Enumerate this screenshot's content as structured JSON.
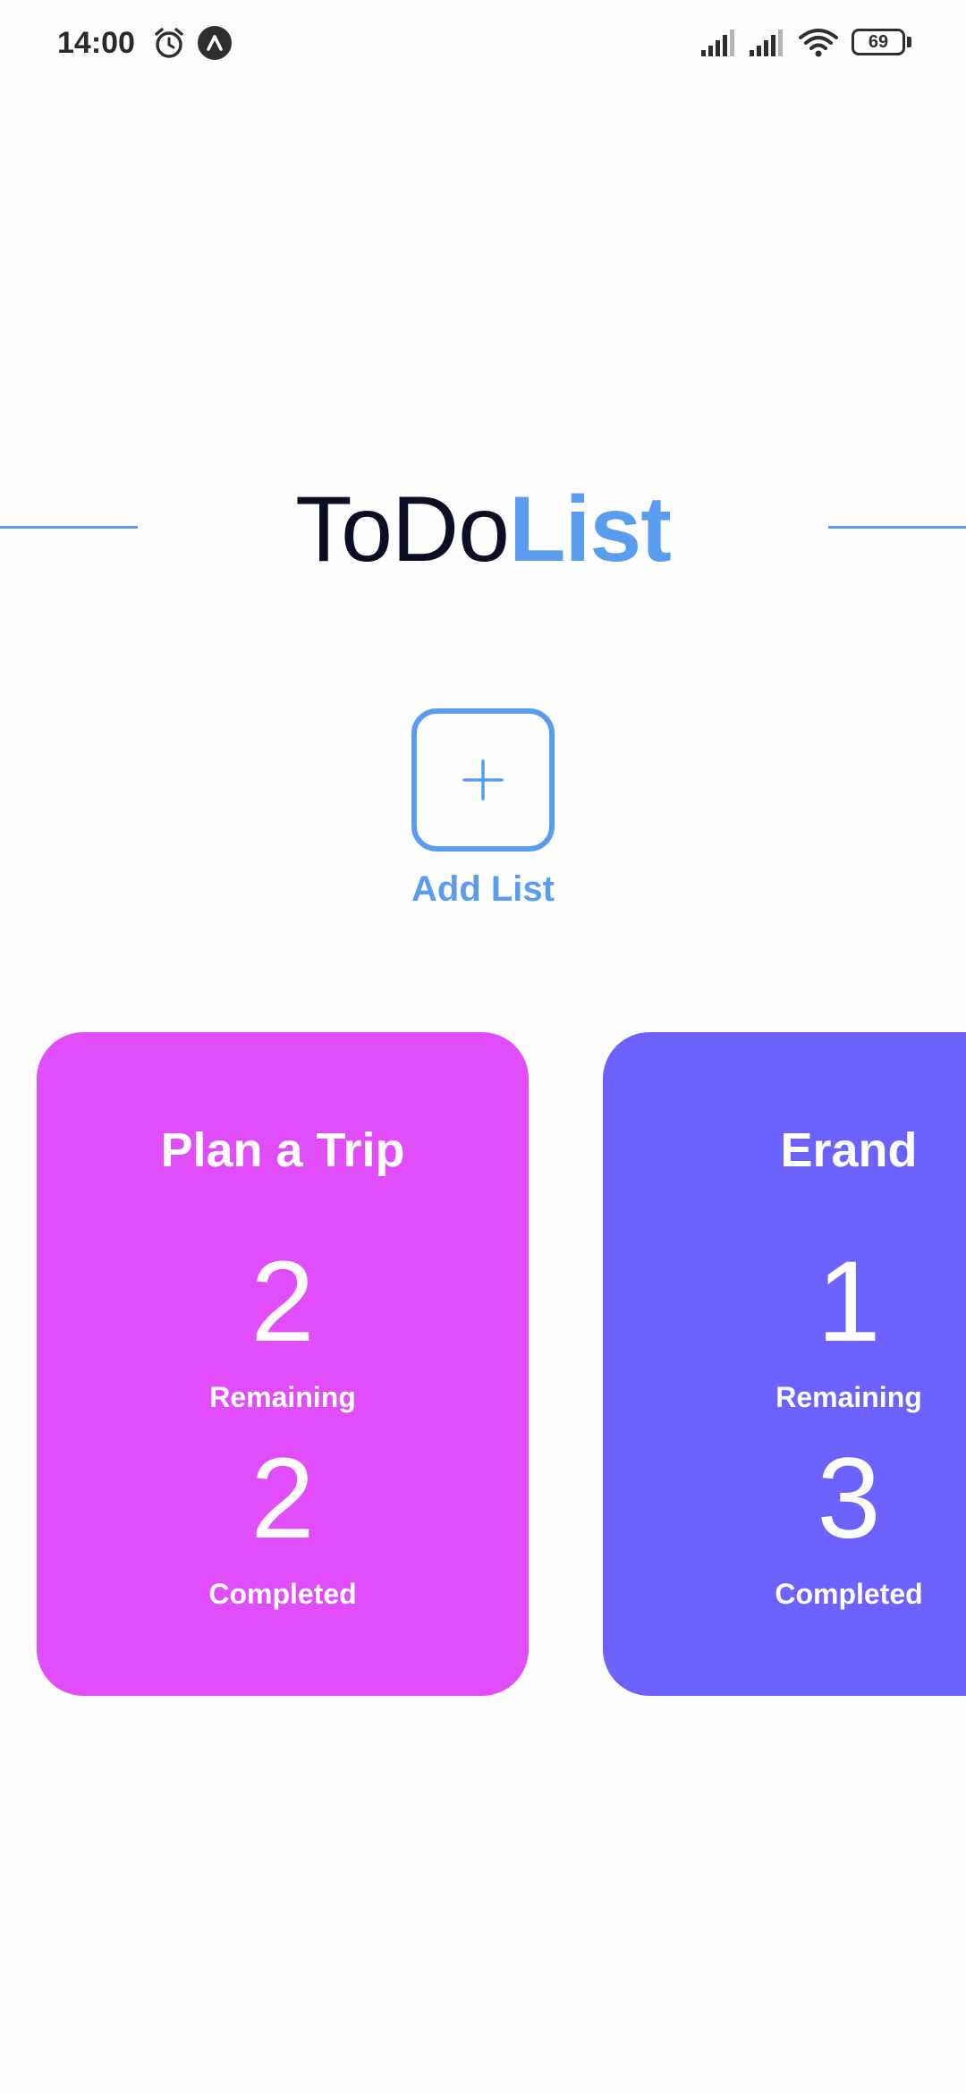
{
  "status_bar": {
    "time": "14:00",
    "battery": "69",
    "icons": [
      "alarm-icon",
      "app-notification-icon",
      "cell-signal-icon",
      "cell-signal-icon",
      "wifi-icon",
      "battery-icon"
    ]
  },
  "header": {
    "title_part1": "ToDo",
    "title_part2": "List",
    "accent_color": "#5a9df0",
    "dark_color": "#0d0d24"
  },
  "add_list": {
    "icon": "plus-icon",
    "label": "Add List"
  },
  "lists": [
    {
      "name": "Plan a Trip",
      "remaining": "2",
      "remaining_label": "Remaining",
      "completed": "2",
      "completed_label": "Completed",
      "color": "#e14cfb"
    },
    {
      "name": "Erand",
      "remaining": "1",
      "remaining_label": "Remaining",
      "completed": "3",
      "completed_label": "Completed",
      "color": "#6c63ff"
    }
  ]
}
